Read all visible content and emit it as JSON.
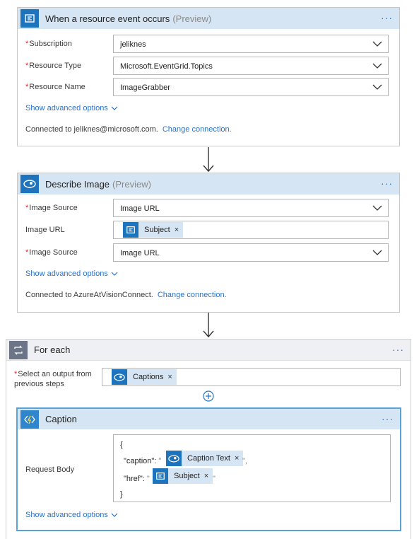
{
  "card1": {
    "title": "When a resource event occurs",
    "preview": "(Preview)",
    "menu": "···",
    "fields": [
      {
        "label": "Subscription",
        "value": "jeliknes"
      },
      {
        "label": "Resource Type",
        "value": "Microsoft.EventGrid.Topics"
      },
      {
        "label": "Resource Name",
        "value": "ImageGrabber"
      }
    ],
    "advanced": "Show advanced options",
    "connected": "Connected to jeliknes@microsoft.com.",
    "change": "Change connection."
  },
  "card2": {
    "title": "Describe Image",
    "preview": "(Preview)",
    "menu": "···",
    "image_source_label": "Image Source",
    "image_source_value": "Image URL",
    "image_url_label": "Image URL",
    "image_url_token": "Subject",
    "image_source2_label": "Image Source",
    "image_source2_value": "Image URL",
    "advanced": "Show advanced options",
    "connected": "Connected to AzureAtVisionConnect.",
    "change": "Change connection."
  },
  "foreach": {
    "title": "For each",
    "menu": "···",
    "select_label_line1": "Select an output from",
    "select_label_line2": "previous steps",
    "token": "Captions",
    "token_remove": "×"
  },
  "caption": {
    "title": "Caption",
    "menu": "···",
    "body_label": "Request Body",
    "line_open": "{",
    "caption_key": "\"caption\":",
    "caption_token": "Caption Text",
    "href_key": "\"href\":",
    "href_token": "Subject",
    "line_close": "}",
    "open_quote": "\"",
    "close_quote_comma": "\",",
    "close_quote": "\"",
    "advanced": "Show advanced options"
  },
  "remove_glyph": "×",
  "add_glyph": "+",
  "colors": {
    "header_blue": "#d6e5f3",
    "icon_blue": "#1e73bd",
    "link_blue": "#2a73c8",
    "loop_gray": "#6b7587",
    "required_red": "#e02020"
  },
  "icons": [
    "event-grid-icon",
    "eye-icon",
    "loop-icon",
    "function-icon",
    "chevron-down-icon",
    "arrow-down-icon",
    "add-step-icon"
  ]
}
